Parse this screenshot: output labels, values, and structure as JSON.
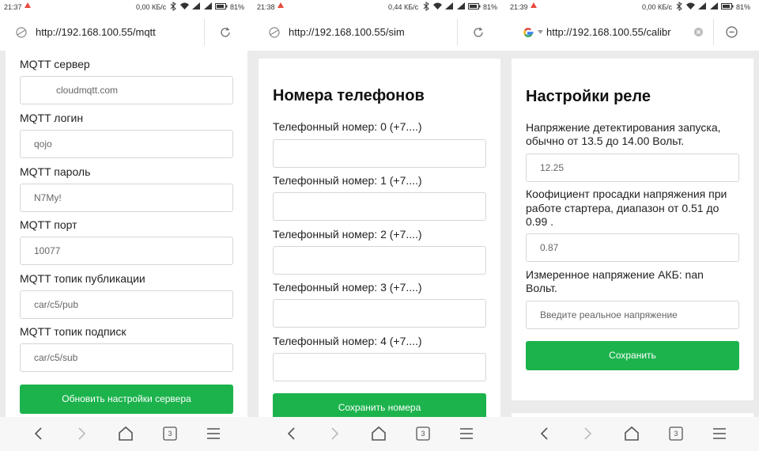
{
  "phones": [
    {
      "status": {
        "time": "21:37",
        "speed": "0,00 КБ/с",
        "battery": "81%"
      },
      "address": {
        "url": "http://192.168.100.55/mqtt"
      },
      "form": {
        "server_label": "MQTT сервер",
        "server_value": "cloudmqtt.com",
        "login_label": "MQTT логин",
        "login_value": "qojo",
        "password_label": "MQTT пароль",
        "password_value": "N7My!",
        "port_label": "MQTT порт",
        "port_value": "10077",
        "pub_label": "MQTT топик публикации",
        "pub_value": "car/c5/pub",
        "sub_label": "MQTT топик подписк",
        "sub_value": "car/c5/sub",
        "submit_label": "Обновить настройки сервера"
      },
      "nav": {
        "tabs_count": "3"
      }
    },
    {
      "status": {
        "time": "21:38",
        "speed": "0,44 КБ/с",
        "battery": "81%"
      },
      "address": {
        "url": "http://192.168.100.55/sim"
      },
      "form": {
        "heading": "Номера телефонов",
        "phone_labels": [
          "Телефонный номер: 0 (+7....)",
          "Телефонный номер: 1 (+7....)",
          "Телефонный номер: 2 (+7....)",
          "Телефонный номер: 3 (+7....)",
          "Телефонный номер: 4 (+7....)"
        ],
        "submit_label": "Сохранить номера"
      },
      "nav": {
        "tabs_count": "3"
      }
    },
    {
      "status": {
        "time": "21:39",
        "speed": "0,00 КБ/с",
        "battery": "81%"
      },
      "address": {
        "url": "http://192.168.100.55/calibr"
      },
      "form": {
        "heading": "Настройки реле",
        "start_voltage_label_1": "Напряжение детектирования запуска,",
        "start_voltage_label_2": "обычно от 13.5 до 14.00 Вольт.",
        "start_voltage_value": "12.25",
        "sag_label_1": "Коофициент просадки напряжения при",
        "sag_label_2": "работе стартера, диапазон от 0.51 до",
        "sag_label_3": "0.99 .",
        "sag_value": "0.87",
        "measured_label_1": "Измеренное напряжение АКБ: nan",
        "measured_label_2": "Вольт.",
        "real_voltage_placeholder": "Введите реальное напряжение",
        "submit_label": "Сохранить"
      },
      "nav": {
        "tabs_count": "3"
      }
    }
  ],
  "icons": {
    "status": [
      "alert-icon",
      "bluetooth-icon",
      "wifi-icon",
      "signal-icon",
      "battery-icon"
    ],
    "address": [
      "site-icon",
      "reload-icon",
      "google-icon",
      "clear-icon",
      "stop-icon"
    ],
    "nav": [
      "back-icon",
      "forward-icon",
      "home-icon",
      "tabs-icon",
      "menu-icon"
    ]
  },
  "colors": {
    "accent_green": "#1cb34d",
    "page_bg": "#ebebeb"
  }
}
